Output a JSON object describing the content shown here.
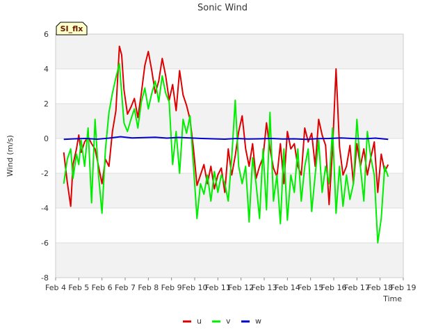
{
  "chart_data": {
    "type": "line",
    "title": "Sonic Wind",
    "xlabel": "Time",
    "ylabel": "Wind (m/s)",
    "badge": "SI_flx",
    "xlim": [
      4,
      19
    ],
    "ylim": [
      -8,
      6
    ],
    "x_ticks": [
      {
        "value": 4,
        "label": "Feb 4"
      },
      {
        "value": 5,
        "label": "Feb 5"
      },
      {
        "value": 6,
        "label": "Feb 6"
      },
      {
        "value": 7,
        "label": "Feb 7"
      },
      {
        "value": 8,
        "label": "Feb 8"
      },
      {
        "value": 9,
        "label": "Feb 9"
      },
      {
        "value": 10,
        "label": "Feb 10"
      },
      {
        "value": 11,
        "label": "Feb 11"
      },
      {
        "value": 12,
        "label": "Feb 12"
      },
      {
        "value": 13,
        "label": "Feb 13"
      },
      {
        "value": 14,
        "label": "Feb 14"
      },
      {
        "value": 15,
        "label": "Feb 15"
      },
      {
        "value": 16,
        "label": "Feb 16"
      },
      {
        "value": 17,
        "label": "Feb 17"
      },
      {
        "value": 18,
        "label": "Feb 18"
      },
      {
        "value": 19,
        "label": "Feb 19"
      }
    ],
    "y_ticks": [
      -8,
      -6,
      -4,
      -2,
      0,
      2,
      4,
      6
    ],
    "grid": true,
    "legend_position": "bottom-center",
    "series": [
      {
        "name": "u",
        "color": "#dd0000",
        "x": [
          4.35,
          4.5,
          4.65,
          4.75,
          4.9,
          5.0,
          5.1,
          5.25,
          5.4,
          5.55,
          5.7,
          5.85,
          6.0,
          6.15,
          6.3,
          6.45,
          6.6,
          6.75,
          6.85,
          6.95,
          7.1,
          7.25,
          7.4,
          7.55,
          7.7,
          7.85,
          8.0,
          8.15,
          8.3,
          8.45,
          8.6,
          8.75,
          8.9,
          9.05,
          9.2,
          9.35,
          9.5,
          9.65,
          9.8,
          9.95,
          10.1,
          10.25,
          10.4,
          10.55,
          10.7,
          10.85,
          11.0,
          11.15,
          11.3,
          11.45,
          11.6,
          11.75,
          11.9,
          12.05,
          12.2,
          12.35,
          12.5,
          12.65,
          12.8,
          12.95,
          13.1,
          13.25,
          13.4,
          13.55,
          13.7,
          13.85,
          14.0,
          14.15,
          14.3,
          14.45,
          14.6,
          14.75,
          14.9,
          15.05,
          15.2,
          15.35,
          15.5,
          15.65,
          15.8,
          15.95,
          16.1,
          16.25,
          16.4,
          16.55,
          16.7,
          16.85,
          17.0,
          17.15,
          17.3,
          17.45,
          17.6,
          17.75,
          17.9,
          18.05,
          18.2,
          18.35
        ],
        "y": [
          -0.8,
          -2.5,
          -3.9,
          -1.5,
          -0.6,
          0.2,
          -0.8,
          -0.2,
          0.1,
          -0.3,
          -0.6,
          -1.6,
          -2.6,
          -1.2,
          -1.6,
          0.4,
          1.6,
          5.3,
          4.8,
          2.8,
          1.4,
          1.8,
          2.3,
          1.2,
          2.6,
          4.2,
          5.0,
          3.9,
          2.6,
          3.3,
          4.6,
          3.6,
          2.2,
          3.1,
          1.6,
          3.9,
          2.5,
          1.9,
          1.1,
          -0.6,
          -2.7,
          -2.1,
          -1.5,
          -2.6,
          -1.6,
          -2.9,
          -2.1,
          -1.7,
          -3.1,
          -0.6,
          -2.1,
          -1.0,
          0.4,
          1.3,
          -0.6,
          -1.6,
          -0.3,
          -2.3,
          -1.6,
          -1.1,
          0.9,
          -0.6,
          -1.7,
          -2.2,
          -0.3,
          -2.6,
          0.4,
          -0.6,
          -0.3,
          -1.6,
          -2.1,
          0.6,
          -0.2,
          0.3,
          -1.6,
          1.1,
          0.2,
          -0.4,
          -3.8,
          -0.6,
          4.0,
          -0.5,
          -2.1,
          -1.6,
          -0.4,
          -2.6,
          -0.3,
          -1.6,
          -0.6,
          -2.1,
          -1.1,
          -0.2,
          -3.1,
          -0.9,
          -1.9,
          -1.5
        ]
      },
      {
        "name": "v",
        "color": "#00ee00",
        "x": [
          4.35,
          4.5,
          4.65,
          4.75,
          4.9,
          5.0,
          5.1,
          5.25,
          5.4,
          5.55,
          5.7,
          5.85,
          6.0,
          6.15,
          6.3,
          6.45,
          6.6,
          6.75,
          6.85,
          6.95,
          7.1,
          7.25,
          7.4,
          7.55,
          7.7,
          7.85,
          8.0,
          8.15,
          8.3,
          8.45,
          8.6,
          8.75,
          8.9,
          9.05,
          9.2,
          9.35,
          9.5,
          9.65,
          9.8,
          9.95,
          10.1,
          10.25,
          10.4,
          10.55,
          10.7,
          10.85,
          11.0,
          11.15,
          11.3,
          11.45,
          11.6,
          11.75,
          11.9,
          12.05,
          12.2,
          12.35,
          12.5,
          12.65,
          12.8,
          12.95,
          13.1,
          13.25,
          13.4,
          13.55,
          13.7,
          13.85,
          14.0,
          14.15,
          14.3,
          14.45,
          14.6,
          14.75,
          14.9,
          15.05,
          15.2,
          15.35,
          15.5,
          15.65,
          15.8,
          15.95,
          16.1,
          16.25,
          16.4,
          16.55,
          16.7,
          16.85,
          17.0,
          17.15,
          17.3,
          17.45,
          17.6,
          17.75,
          17.9,
          18.05,
          18.2,
          18.35
        ],
        "y": [
          -2.6,
          -1.2,
          -0.6,
          -2.3,
          -0.9,
          -1.5,
          -0.1,
          -1.6,
          0.6,
          -3.7,
          1.1,
          -2.1,
          -4.3,
          -0.6,
          1.5,
          2.6,
          3.5,
          4.3,
          2.6,
          0.9,
          0.4,
          1.1,
          1.7,
          0.6,
          2.1,
          2.9,
          1.7,
          2.6,
          3.3,
          2.1,
          3.6,
          2.6,
          2.1,
          -1.5,
          0.4,
          -2.0,
          1.1,
          0.3,
          1.3,
          -1.6,
          -4.6,
          -2.6,
          -3.2,
          -2.1,
          -3.6,
          -1.9,
          -3.1,
          -2.1,
          -2.6,
          -3.6,
          -1.1,
          2.2,
          -1.6,
          -2.6,
          -1.6,
          -4.8,
          -1.1,
          -2.6,
          -4.6,
          -0.6,
          -4.1,
          1.5,
          -3.6,
          -2.1,
          -4.9,
          -0.6,
          -4.7,
          -2.1,
          -3.1,
          -0.6,
          -3.6,
          -1.6,
          -0.6,
          -4.2,
          -2.1,
          -0.1,
          -3.1,
          -1.6,
          -2.6,
          0.6,
          -4.3,
          -1.6,
          -3.9,
          -2.1,
          -3.5,
          -2.6,
          1.1,
          -1.6,
          -3.6,
          0.4,
          -1.1,
          -2.1,
          -6.0,
          -4.6,
          -1.6,
          -2.2
        ]
      },
      {
        "name": "w",
        "color": "#0000cc",
        "x": [
          4.35,
          4.8,
          5.3,
          5.8,
          6.3,
          6.8,
          7.3,
          7.8,
          8.3,
          8.8,
          9.3,
          9.8,
          10.3,
          10.8,
          11.3,
          11.8,
          12.3,
          12.8,
          13.3,
          13.8,
          14.3,
          14.8,
          15.3,
          15.8,
          16.3,
          16.8,
          17.3,
          17.8,
          18.35
        ],
        "y": [
          -0.05,
          -0.02,
          0.0,
          -0.04,
          0.02,
          0.1,
          0.03,
          0.05,
          0.07,
          0.02,
          0.06,
          0.03,
          0.0,
          -0.02,
          -0.04,
          0.0,
          -0.03,
          -0.02,
          0.0,
          -0.03,
          -0.02,
          -0.05,
          -0.01,
          0.0,
          0.03,
          0.0,
          -0.02,
          0.02,
          -0.05
        ]
      }
    ]
  }
}
